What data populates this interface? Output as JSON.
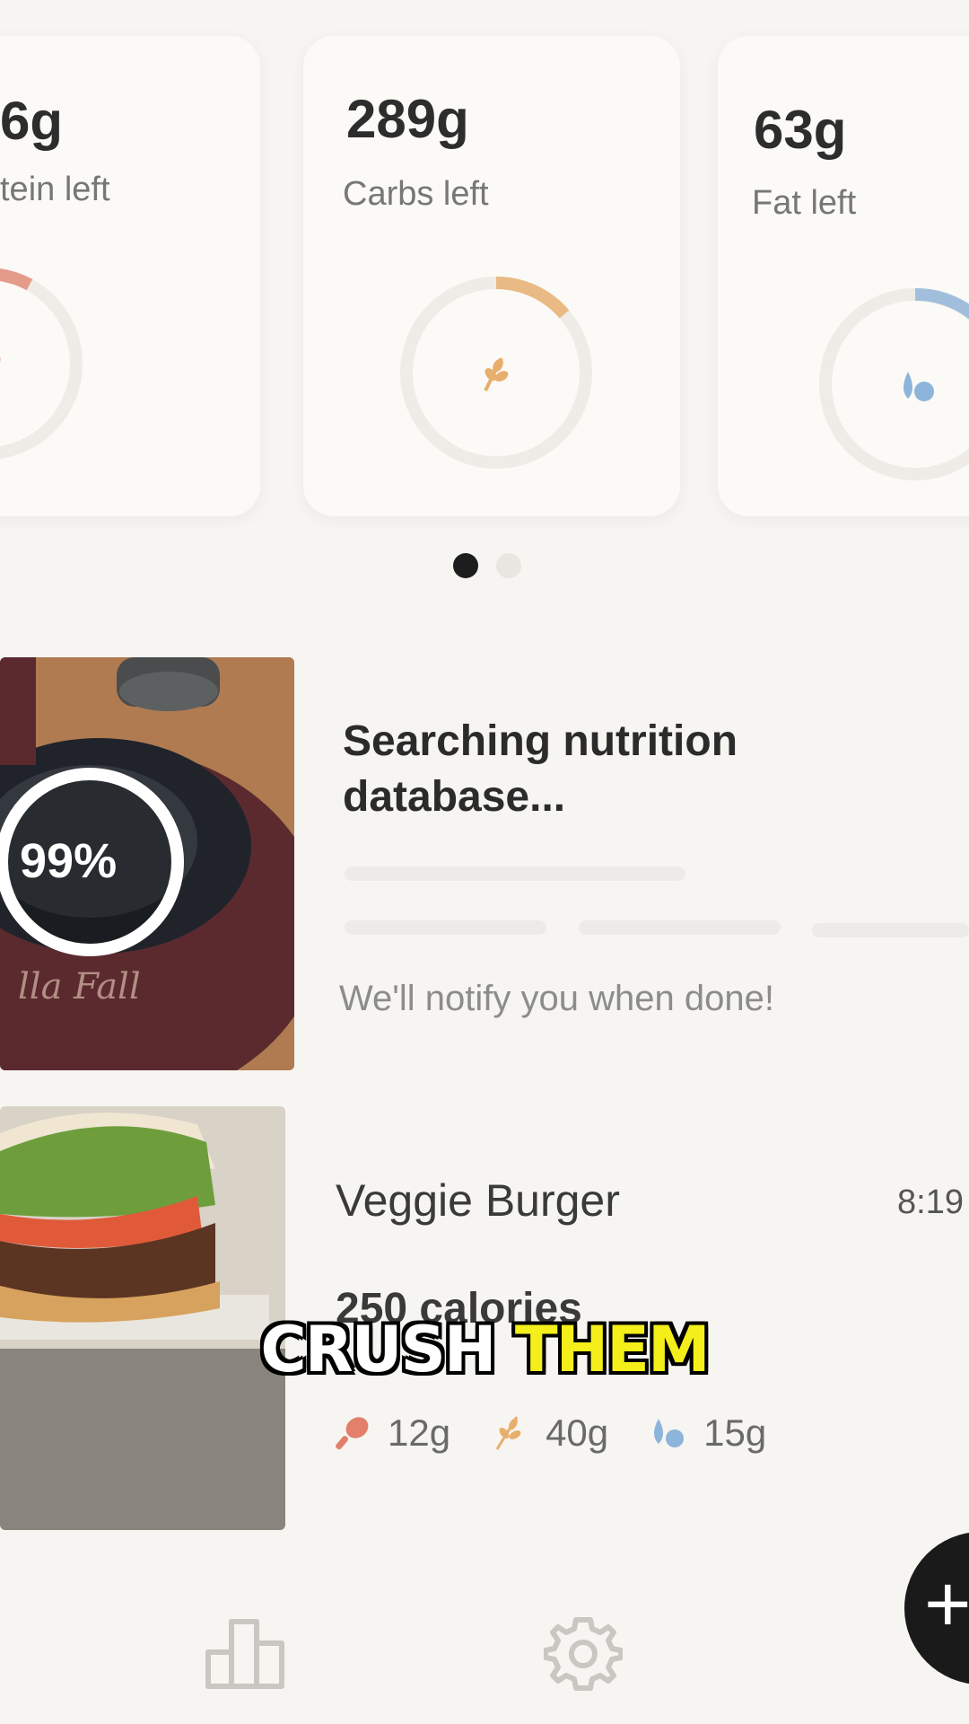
{
  "macros": [
    {
      "value": "6g",
      "label": "tein left",
      "icon": "drumstick-icon",
      "color": "#e2806b",
      "progress": 0.08
    },
    {
      "value": "289g",
      "label": "Carbs left",
      "icon": "wheat-icon",
      "color": "#e7ae6c",
      "progress": 0.12
    },
    {
      "value": "63g",
      "label": "Fat left",
      "icon": "oil-drops-icon",
      "color": "#8db4da",
      "progress": 0.15
    }
  ],
  "pager": {
    "count": 2,
    "active": 0
  },
  "analyzing": {
    "percent": "99%",
    "title": "Searching nutrition database...",
    "note": "We'll notify you when done!"
  },
  "meal": {
    "name": "Veggie Burger",
    "time": "8:19",
    "calories": "250 calories",
    "protein": "12g",
    "carbs": "40g",
    "fat": "15g"
  },
  "caption": {
    "word1": "CRUSH",
    "word2": "THEM"
  },
  "nav": {
    "analytics_icon": "bar-chart-icon",
    "settings_icon": "gear-icon",
    "add_icon": "plus-icon"
  }
}
